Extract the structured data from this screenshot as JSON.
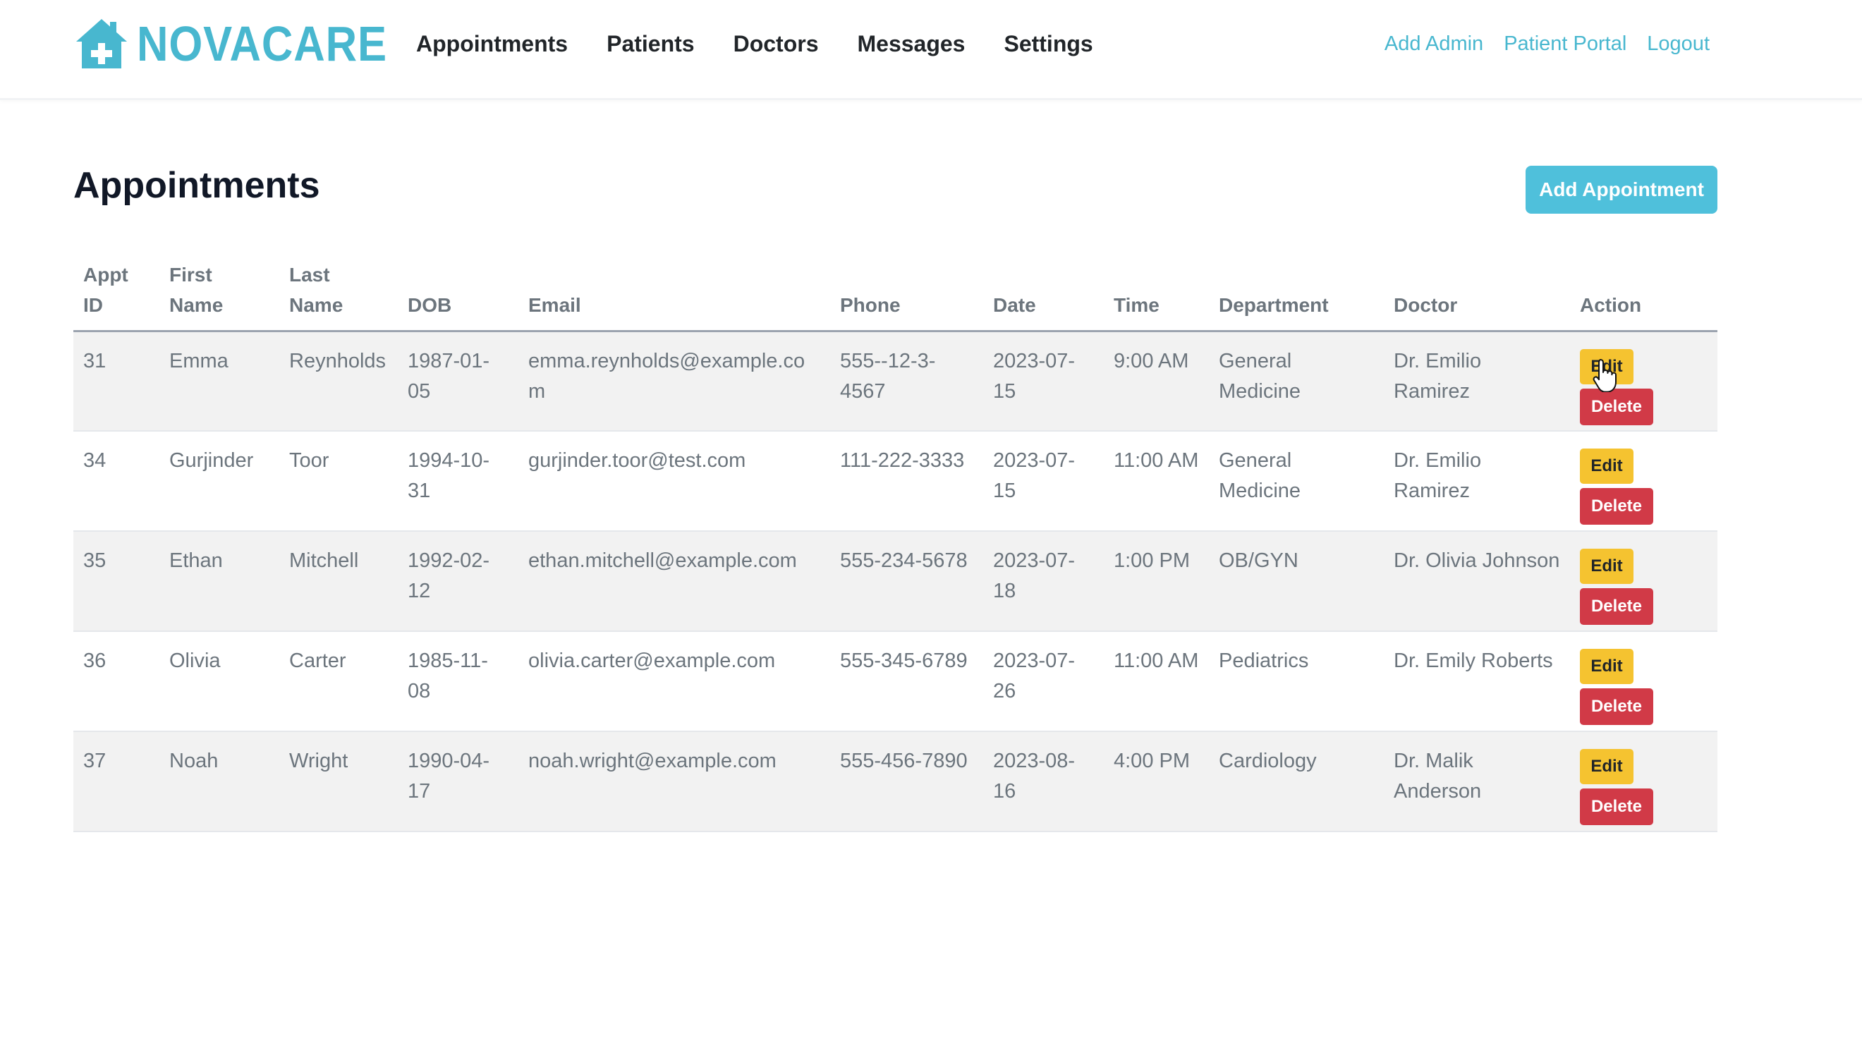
{
  "brand": {
    "name": "NOVACARE",
    "icon": "house-medical-icon",
    "color": "#48b7cf"
  },
  "nav": {
    "links": [
      "Appointments",
      "Patients",
      "Doctors",
      "Messages",
      "Settings"
    ],
    "right_links": [
      "Add Admin",
      "Patient Portal",
      "Logout"
    ]
  },
  "main": {
    "title": "Appointments",
    "add_button": "Add Appointment"
  },
  "table": {
    "headers": {
      "appt_id": "Appt ID",
      "first_name": "First Name",
      "last_name": "Last Name",
      "dob": "DOB",
      "email": "Email",
      "phone": "Phone",
      "date": "Date",
      "time": "Time",
      "department": "Department",
      "doctor": "Doctor",
      "action": "Action"
    },
    "edit_label": "Edit",
    "delete_label": "Delete",
    "rows": [
      {
        "appt_id": "31",
        "first_name": "Emma",
        "last_name": "Reynholds",
        "dob": "1987-01-05",
        "email": "emma.reynholds@example.com",
        "phone": "555--12-3-4567",
        "date": "2023-07-15",
        "time": "9:00 AM",
        "department": "General Medicine",
        "doctor": "Dr. Emilio Ramirez"
      },
      {
        "appt_id": "34",
        "first_name": "Gurjinder",
        "last_name": "Toor",
        "dob": "1994-10-31",
        "email": "gurjinder.toor@test.com",
        "phone": "111-222-3333",
        "date": "2023-07-15",
        "time": "11:00 AM",
        "department": "General Medicine",
        "doctor": "Dr. Emilio Ramirez"
      },
      {
        "appt_id": "35",
        "first_name": "Ethan",
        "last_name": "Mitchell",
        "dob": "1992-02-12",
        "email": "ethan.mitchell@example.com",
        "phone": "555-234-5678",
        "date": "2023-07-18",
        "time": "1:00 PM",
        "department": "OB/GYN",
        "doctor": "Dr. Olivia Johnson"
      },
      {
        "appt_id": "36",
        "first_name": "Olivia",
        "last_name": "Carter",
        "dob": "1985-11-08",
        "email": "olivia.carter@example.com",
        "phone": "555-345-6789",
        "date": "2023-07-26",
        "time": "11:00 AM",
        "department": "Pediatrics",
        "doctor": "Dr. Emily Roberts"
      },
      {
        "appt_id": "37",
        "first_name": "Noah",
        "last_name": "Wright",
        "dob": "1990-04-17",
        "email": "noah.wright@example.com",
        "phone": "555-456-7890",
        "date": "2023-08-16",
        "time": "4:00 PM",
        "department": "Cardiology",
        "doctor": "Dr. Malik Anderson"
      }
    ]
  },
  "colors": {
    "accent": "#48b7cf",
    "add_button": "#4fc0db",
    "edit_button": "#f5c330",
    "delete_button": "#d13a47"
  }
}
